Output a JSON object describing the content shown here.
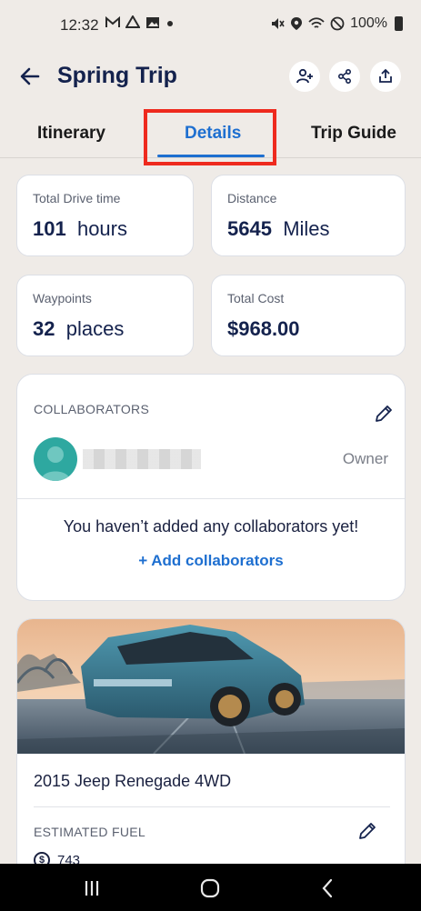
{
  "status_bar": {
    "time": "12:32",
    "notification_icons": [
      "mail-icon",
      "drive-icon",
      "image-icon",
      "dot-icon"
    ],
    "battery": "100%"
  },
  "header": {
    "title": "Spring Trip",
    "actions": [
      "add-person-icon",
      "share-icon",
      "upload-icon"
    ]
  },
  "tabs": [
    {
      "label": "Itinerary",
      "active": false
    },
    {
      "label": "Details",
      "active": true
    },
    {
      "label": "Trip Guide",
      "active": false
    }
  ],
  "stats": {
    "drive_time": {
      "label": "Total Drive time",
      "value": "101",
      "unit": "hours"
    },
    "distance": {
      "label": "Distance",
      "value": "5645",
      "unit": "Miles"
    },
    "waypoints": {
      "label": "Waypoints",
      "value": "32",
      "unit": "places"
    },
    "cost": {
      "label": "Total Cost",
      "value": "$968.00"
    }
  },
  "collaborators": {
    "title": "COLLABORATORS",
    "owner_label": "Owner",
    "empty_message": "You haven’t added any collaborators yet!",
    "add_label": "+ Add collaborators"
  },
  "vehicle": {
    "name": "2015 Jeep Renegade 4WD",
    "fuel_title": "ESTIMATED FUEL",
    "fuel_value": "743"
  },
  "colors": {
    "accent": "#1e6fd0",
    "title": "#14224d",
    "highlight": "#ee2a1e",
    "avatar": "#2ea8a0"
  }
}
